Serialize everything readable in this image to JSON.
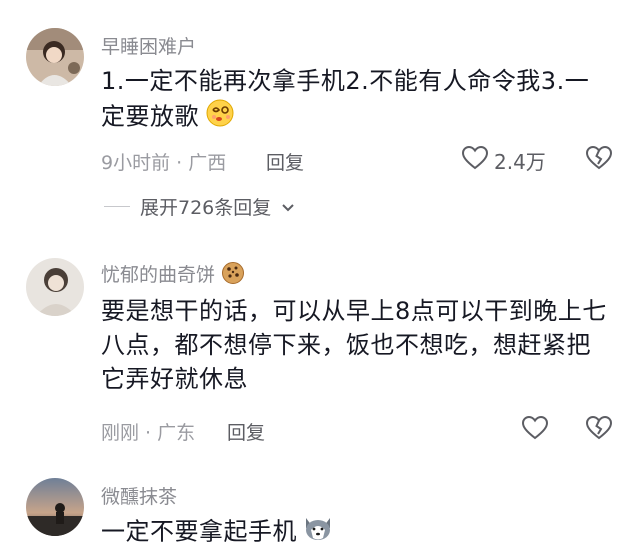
{
  "comments": [
    {
      "username": "早睡困难户",
      "text": "1.一定不能再次拿手机2.不能有人命令我3.一定要放歌",
      "meta": "9小时前 · 广西",
      "reply_label": "回复",
      "like_count": "2.4万",
      "expand_label": "展开726条回复",
      "emoji_icon": "dizzy-face-icon"
    },
    {
      "username": "忧郁的曲奇饼",
      "text": "要是想干的话，可以从早上8点可以干到晚上七八点，都不想停下来，饭也不想吃，想赶紧把它弄好就休息",
      "meta": "刚刚 · 广东",
      "reply_label": "回复",
      "emoji_icon": "cookie-icon"
    },
    {
      "username": "微醺抹茶",
      "text": "一定不要拿起手机",
      "emoji_icon": "husky-icon"
    }
  ],
  "colors": {
    "text": "#161823",
    "secondary": "#8a8b91",
    "accent": "#5c5d63"
  }
}
